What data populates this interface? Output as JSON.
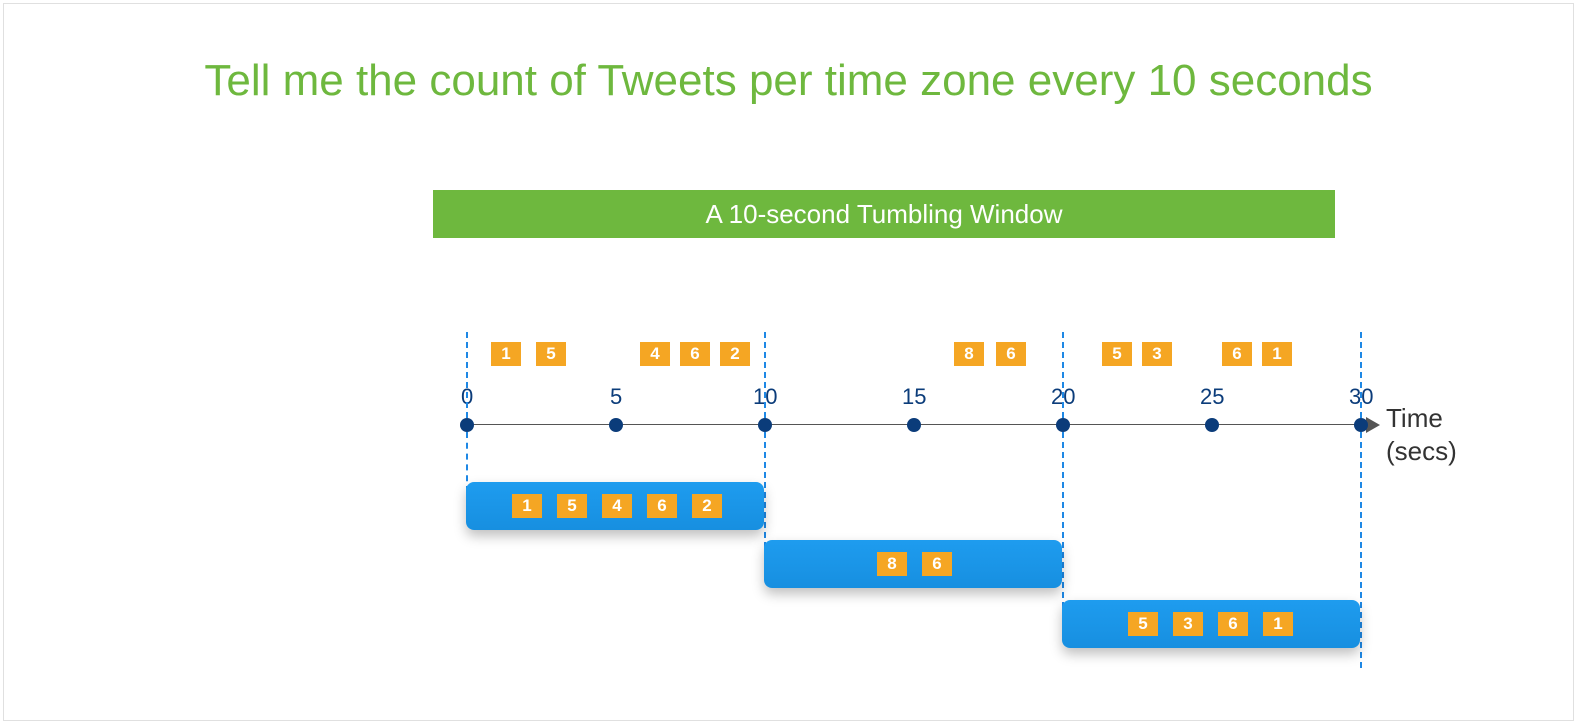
{
  "title": "Tell me the count of Tweets per time zone every 10 seconds",
  "subtitle": "A 10-second Tumbling Window",
  "axis": {
    "title_line1": "Time",
    "title_line2": "(secs)",
    "ticks": {
      "t0": "0",
      "t5": "5",
      "t10": "10",
      "t15": "15",
      "t20": "20",
      "t25": "25",
      "t30": "30"
    }
  },
  "events": {
    "e1": "1",
    "e2": "5",
    "e3": "4",
    "e4": "6",
    "e5": "2",
    "e6": "8",
    "e7": "6",
    "e8": "5",
    "e9": "3",
    "e10": "6",
    "e11": "1"
  },
  "windows": {
    "w1": {
      "v1": "1",
      "v2": "5",
      "v3": "4",
      "v4": "6",
      "v5": "2"
    },
    "w2": {
      "v1": "8",
      "v2": "6"
    },
    "w3": {
      "v1": "5",
      "v2": "3",
      "v3": "6",
      "v4": "1"
    }
  }
}
